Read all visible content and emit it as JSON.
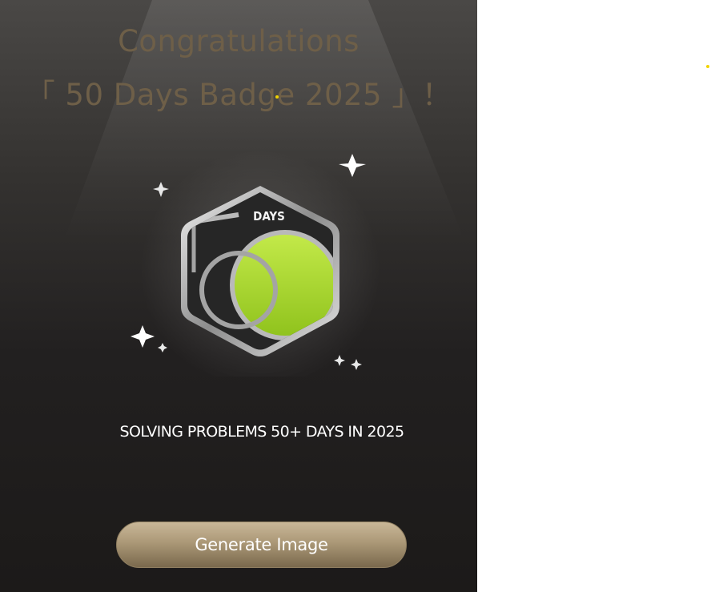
{
  "modal": {
    "title_line1": "Congratulations",
    "title_line2": "「 50 Days Badge 2025 」！",
    "badge": {
      "label": "DAYS",
      "accent_color": "#a9d42c",
      "frame_color": "#c8c8c8"
    },
    "caption": "SOLVING PROBLEMS 50+ DAYS IN 2025",
    "generate_button_label": "Generate Image",
    "colors": {
      "title": "#6e5f48",
      "button_gold": "#ab9877",
      "background_dark": "#1c1a19"
    }
  }
}
